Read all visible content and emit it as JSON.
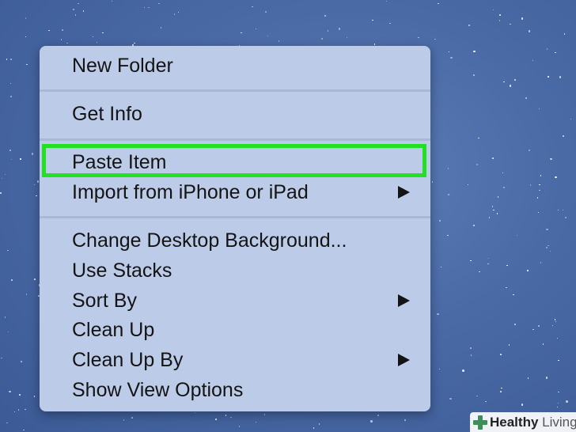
{
  "context_menu": {
    "items": [
      {
        "label": "New Folder",
        "has_submenu": false
      },
      {
        "label": "Get Info",
        "has_submenu": false
      },
      {
        "label": "Paste Item",
        "has_submenu": false,
        "highlighted": true
      },
      {
        "label": "Import from iPhone or iPad",
        "has_submenu": true
      },
      {
        "label": "Change Desktop Background...",
        "has_submenu": false
      },
      {
        "label": "Use Stacks",
        "has_submenu": false
      },
      {
        "label": "Sort By",
        "has_submenu": true
      },
      {
        "label": "Clean Up",
        "has_submenu": false
      },
      {
        "label": "Clean Up By",
        "has_submenu": true
      },
      {
        "label": "Show View Options",
        "has_submenu": false
      }
    ],
    "highlight_color": "#22e022"
  },
  "watermark": {
    "bold": "Healthy",
    "light": "Living",
    "icon": "medical-cross-icon"
  }
}
